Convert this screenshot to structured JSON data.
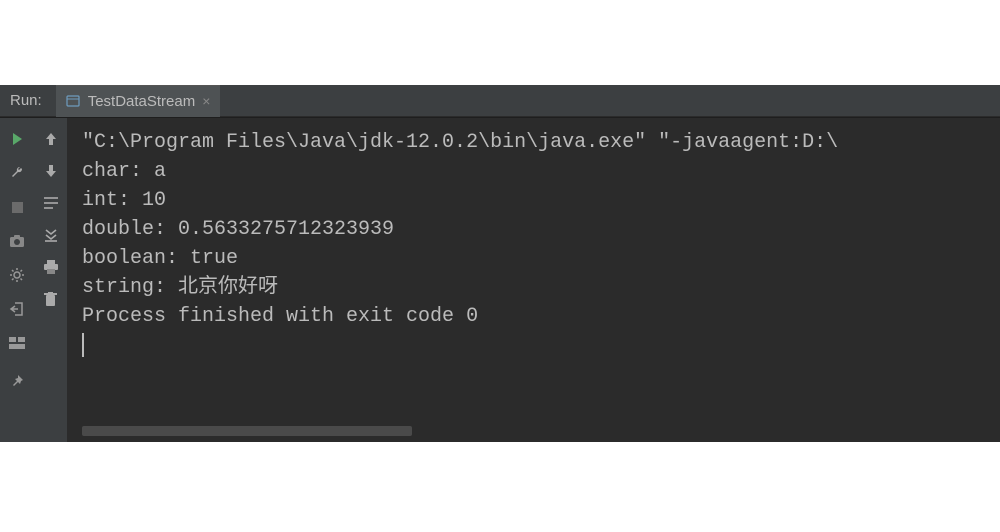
{
  "panel_label": "Run:",
  "tab": {
    "label": "TestDataStream",
    "close": "×"
  },
  "console": {
    "lines": [
      "\"C:\\Program Files\\Java\\jdk-12.0.2\\bin\\java.exe\" \"-javaagent:D:\\",
      "char: a",
      "int: 10",
      "double: 0.5633275712323939",
      "boolean: true",
      "string: 北京你好呀",
      "",
      "Process finished with exit code 0"
    ]
  },
  "icons": {
    "run": "run-icon",
    "wrench": "wrench-icon",
    "stop": "stop-icon",
    "camera": "camera-icon",
    "gear": "gear-icon",
    "exit": "exit-icon",
    "layout": "layout-icon",
    "pin": "pin-icon",
    "up": "up-arrow-icon",
    "down": "down-arrow-icon",
    "wrap": "soft-wrap-icon",
    "scroll-end": "scroll-to-end-icon",
    "print": "print-icon",
    "trash": "trash-icon"
  }
}
